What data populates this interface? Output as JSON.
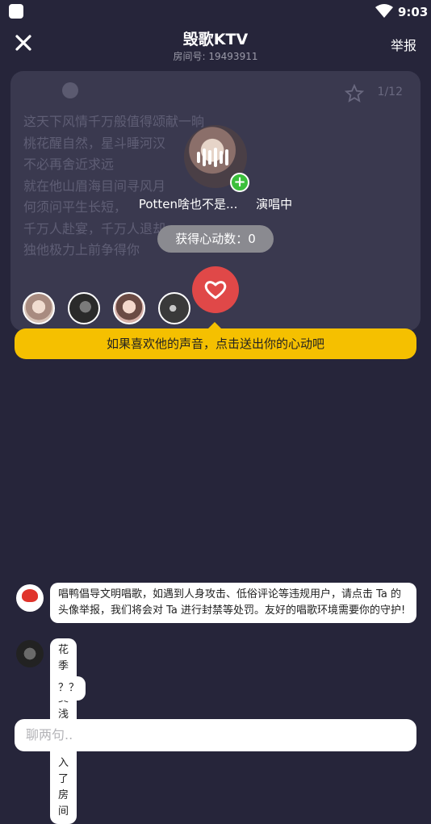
{
  "status_bar": {
    "time": "9:03"
  },
  "header": {
    "title": "毁歌KTV",
    "room_number": "房间号: 19493911",
    "report_label": "举报"
  },
  "lyrics": {
    "page_indicator": "1/12",
    "lines": [
      "这天下风情千万般值得颂献一晌",
      "桃花醒自然，星斗睡河汉",
      "不必再舍近求远",
      "就在他山眉海目间寻风月",
      "何须问平生长短，",
      "千万人赴宴，千万人退却，",
      "独他极力上前争得你"
    ]
  },
  "singer": {
    "name": "Potten啥也不是...",
    "status": "演唱中",
    "hearts_label": "获得心动数：0"
  },
  "tip": "如果喜欢他的声音，点击送出你的心动吧",
  "chat": [
    {
      "text": "唱鸭倡导文明唱歌，如遇到人身攻击、低俗评论等违规用户，请点击 Ta 的头像举报，我们将会对 Ta 进行封禁等处罚。友好的唱歌环境需要你的守护!"
    },
    {
      "text": "花季•莫浅忆 加入了房间"
    },
    {
      "text": "？？"
    }
  ],
  "input": {
    "placeholder": "聊两句.."
  },
  "colors": {
    "accent_red": "#e04848",
    "tip_yellow": "#f5c000",
    "background": "#26253a"
  }
}
